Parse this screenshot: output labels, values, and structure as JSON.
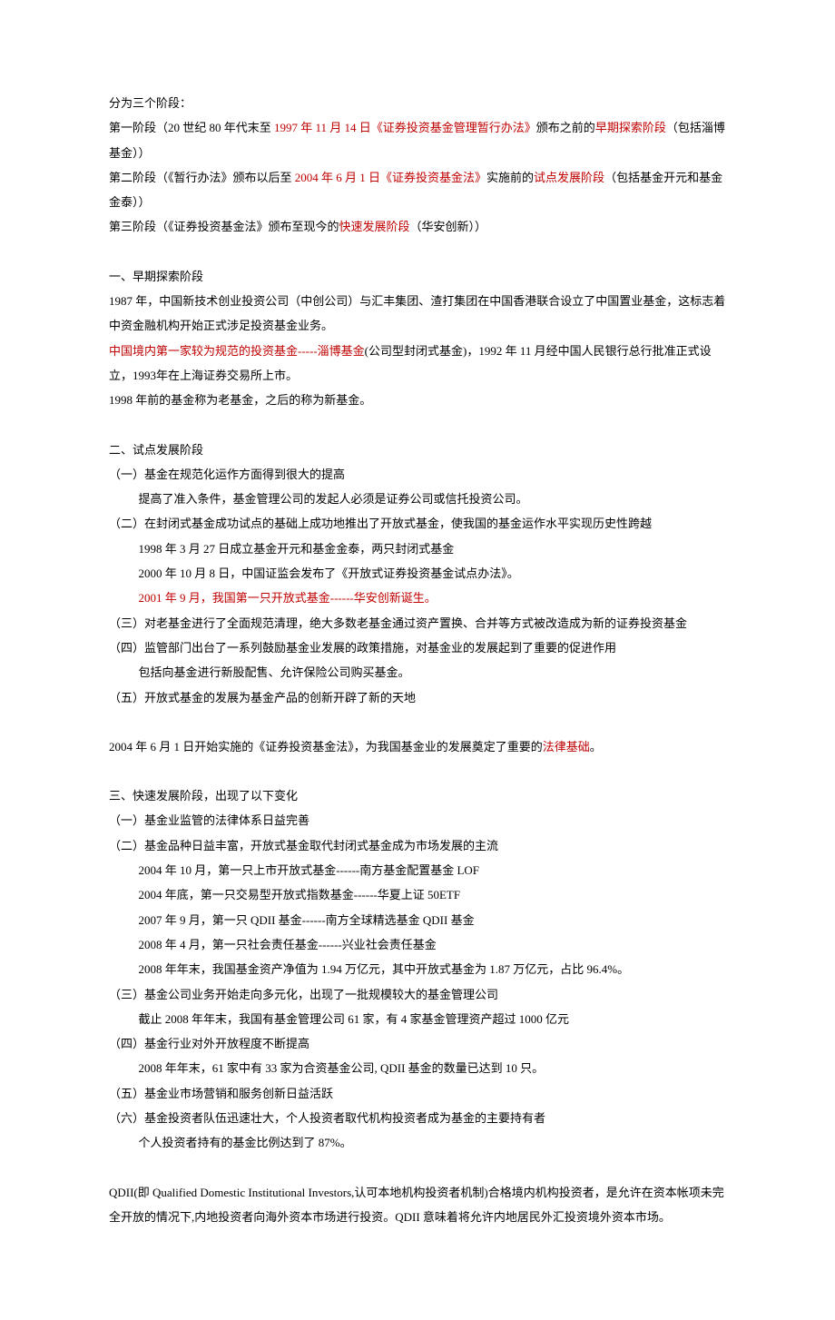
{
  "p1": "分为三个阶段：",
  "p2a": "第一阶段（20 世纪 80 年代末至 ",
  "p2b": "1997 年 11 月 14 日《证券投资基金管理暂行办法》",
  "p2c": "颁布之前的",
  "p2d": "早期探索阶段",
  "p2e": "（包括淄博基金））",
  "p3a": "第二阶段（《暂行办法》颁布以后至 ",
  "p3b": "2004 年 6 月 1 日《证券投资基金法》",
  "p3c": "实施前的",
  "p3d": "试点发展阶段",
  "p3e": "（包括基金开元和基金金泰））",
  "p4a": "第三阶段（《证券投资基金法》颁布至现今的",
  "p4b": "快速发展阶段",
  "p4c": "（华安创新））",
  "s1_title": "一、早期探索阶段",
  "s1_p1": "1987 年，中国新技术创业投资公司（中创公司）与汇丰集团、渣打集团在中国香港联合设立了中国置业基金，这标志着中资金融机构开始正式涉足投资基金业务。",
  "s1_p2a": "中国境内第一家较为规范的投资基金-----淄博基金",
  "s1_p2b": "(公司型封闭式基金)，1992 年 11 月经中国人民银行总行批准正式设立，1993年在上海证券交易所上市。",
  "s1_p3": "1998 年前的基金称为老基金，之后的称为新基金。",
  "s2_title": "二、试点发展阶段",
  "s2_i1": "（一）基金在规范化运作方面得到很大的提高",
  "s2_i1_sub": "提高了准入条件，基金管理公司的发起人必须是证券公司或信托投资公司。",
  "s2_i2": "（二）在封闭式基金成功试点的基础上成功地推出了开放式基金，使我国的基金运作水平实现历史性跨越",
  "s2_i2_sub1": "1998 年 3 月 27 日成立基金开元和基金金泰，两只封闭式基金",
  "s2_i2_sub2": "2000 年 10 月 8 日，中国证监会发布了《开放式证券投资基金试点办法》。",
  "s2_i2_sub3": "2001 年 9 月，我国第一只开放式基金------华安创新诞生。",
  "s2_i3": "（三）对老基金进行了全面规范清理，绝大多数老基金通过资产置换、合并等方式被改造成为新的证券投资基金",
  "s2_i4": "（四）监管部门出台了一系列鼓励基金业发展的政策措施，对基金业的发展起到了重要的促进作用",
  "s2_i4_sub": "包括向基金进行新股配售、允许保险公司购买基金。",
  "s2_i5": "（五）开放式基金的发展为基金产品的创新开辟了新的天地",
  "s2_p_last_a": "2004 年 6 月 1 日开始实施的《证券投资基金法》，为我国基金业的发展奠定了重要的",
  "s2_p_last_b": "法律基础",
  "s2_p_last_c": "。",
  "s3_title": "三、快速发展阶段，出现了以下变化",
  "s3_i1": "（一）基金业监管的法律体系日益完善",
  "s3_i2": "（二）基金品种日益丰富，开放式基金取代封闭式基金成为市场发展的主流",
  "s3_i2_sub1": "2004 年 10 月，第一只上市开放式基金------南方基金配置基金 LOF",
  "s3_i2_sub2": "2004 年底，第一只交易型开放式指数基金------华夏上证 50ETF",
  "s3_i2_sub3": "2007 年 9 月，第一只 QDII 基金------南方全球精选基金 QDII 基金",
  "s3_i2_sub4": "2008 年 4 月，第一只社会责任基金------兴业社会责任基金",
  "s3_i2_sub5": "2008 年年末，我国基金资产净值为 1.94 万亿元，其中开放式基金为 1.87 万亿元，占比 96.4%。",
  "s3_i3": "（三）基金公司业务开始走向多元化，出现了一批规模较大的基金管理公司",
  "s3_i3_sub": "截止 2008 年年末，我国有基金管理公司 61 家，有 4 家基金管理资产超过 1000 亿元",
  "s3_i4": "（四）基金行业对外开放程度不断提高",
  "s3_i4_sub": "2008 年年末，61 家中有 33 家为合资基金公司, QDII 基金的数量已达到 10 只。",
  "s3_i5": "（五）基金业市场营销和服务创新日益活跃",
  "s3_i6": "（六）基金投资者队伍迅速壮大，个人投资者取代机构投资者成为基金的主要持有者",
  "s3_i6_sub": "个人投资者持有的基金比例达到了 87%。",
  "qdii": "QDII(即 Qualified Domestic Institutional Investors,认可本地机构投资者机制)合格境内机构投资者，是允许在资本帐项未完全开放的情况下,内地投资者向海外资本市场进行投资。QDII 意味着将允许内地居民外汇投资境外资本市场。"
}
